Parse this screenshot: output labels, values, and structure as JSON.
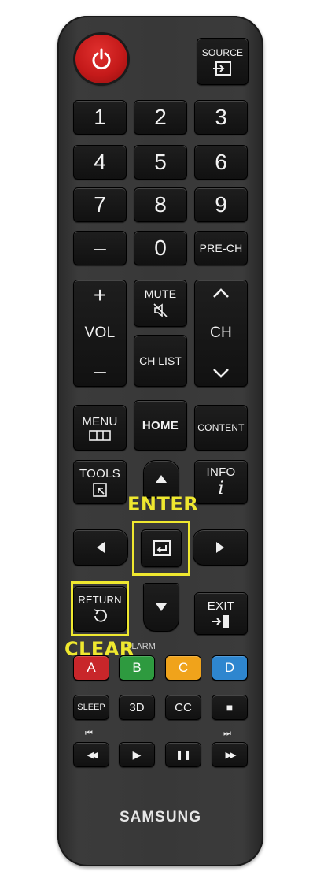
{
  "remote": {
    "brand": "SAMSUNG",
    "source_label": "SOURCE",
    "source_icon": "input-icon",
    "number_keys": [
      "1",
      "2",
      "3",
      "4",
      "5",
      "6",
      "7",
      "8",
      "9",
      "–",
      "0"
    ],
    "prech_label": "PRE-CH",
    "vol_label": "VOL",
    "vol_up": "+",
    "vol_down": "–",
    "mute_label": "MUTE",
    "chlist_label": "CH LIST",
    "ch_label": "CH",
    "menu_label": "MENU",
    "home_label": "HOME",
    "content_label": "CONTENT",
    "tools_label": "TOOLS",
    "info_label": "INFO",
    "info_glyph": "i",
    "return_label": "RETURN",
    "exit_label": "EXIT",
    "alarm_label": "ALARM",
    "color_keys": [
      {
        "label": "A",
        "color": "#c8262a"
      },
      {
        "label": "B",
        "color": "#2e9a3f"
      },
      {
        "label": "C",
        "color": "#f0a31b"
      },
      {
        "label": "D",
        "color": "#2e86cf"
      }
    ],
    "sleep_label": "SLEEP",
    "threed_label": "3D",
    "cc_label": "CC",
    "stop_glyph": "■",
    "rewind_glyph": "◀◀",
    "play_glyph": "▶",
    "pause_glyph": "❚❚",
    "ff_glyph": "▶▶",
    "prev_glyph": "⏮",
    "next_glyph": "⏭"
  },
  "annotations": {
    "enter_label": "ENTER",
    "clear_label": "CLEAR",
    "highlight_color": "#efe82f"
  }
}
